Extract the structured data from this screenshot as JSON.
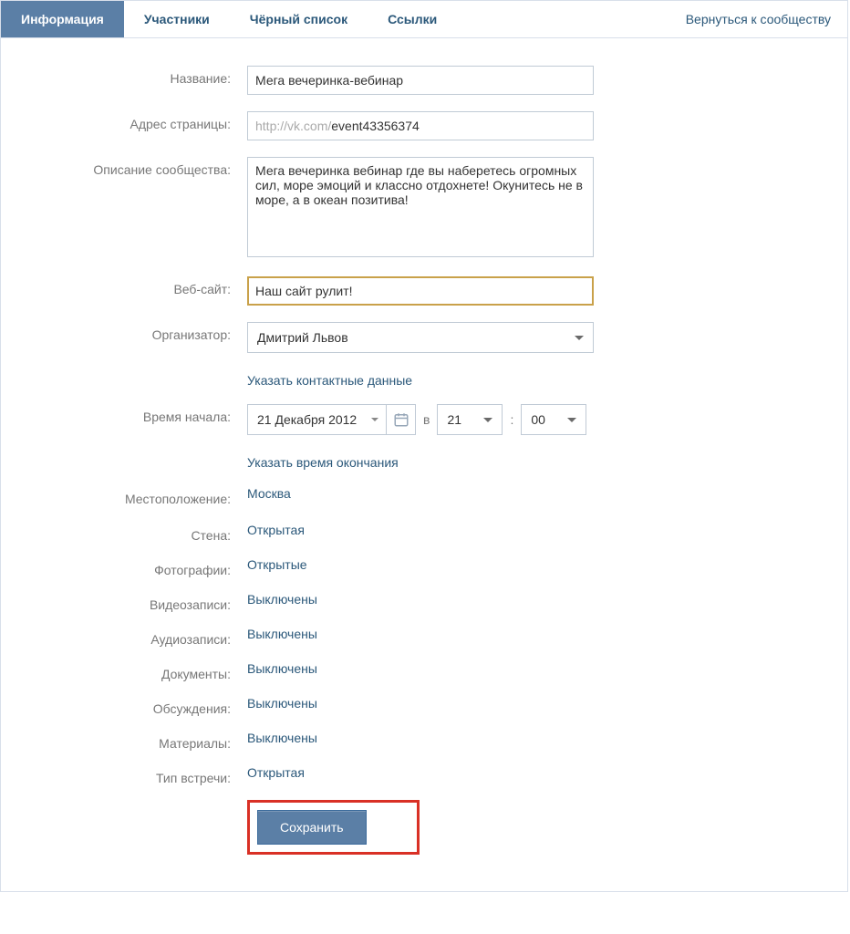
{
  "tabs": {
    "info": "Информация",
    "members": "Участники",
    "blacklist": "Чёрный список",
    "links": "Ссылки"
  },
  "back_link": "Вернуться к сообществу",
  "form": {
    "name_label": "Название:",
    "name_value": "Мега вечеринка-вебинар",
    "address_label": "Адрес страницы:",
    "address_prefix": "http://vk.com/",
    "address_value": "event43356374",
    "desc_label": "Описание сообщества:",
    "desc_value": "Мега вечеринка вебинар где вы наберетесь огромных сил, море эмоций и классно отдохнете! Окунитесь не в море, а в океан позитива!",
    "website_label": "Веб-сайт:",
    "website_value": "Наш сайт рулит!",
    "organizer_label": "Организатор:",
    "organizer_value": "Дмитрий Львов",
    "contact_link": "Указать контактные данные",
    "start_label": "Время начала:",
    "start_date": "21 Декабря 2012",
    "start_sep": "в",
    "start_hour": "21",
    "start_colon": ":",
    "start_minute": "00",
    "endtime_link": "Указать время окончания",
    "location_label": "Местоположение:",
    "location_value": "Москва",
    "wall_label": "Стена:",
    "wall_value": "Открытая",
    "photos_label": "Фотографии:",
    "photos_value": "Открытые",
    "videos_label": "Видеозаписи:",
    "videos_value": "Выключены",
    "audios_label": "Аудиозаписи:",
    "audios_value": "Выключены",
    "docs_label": "Документы:",
    "docs_value": "Выключены",
    "discussions_label": "Обсуждения:",
    "discussions_value": "Выключены",
    "materials_label": "Материалы:",
    "materials_value": "Выключены",
    "meettype_label": "Тип встречи:",
    "meettype_value": "Открытая",
    "save_btn": "Сохранить"
  }
}
